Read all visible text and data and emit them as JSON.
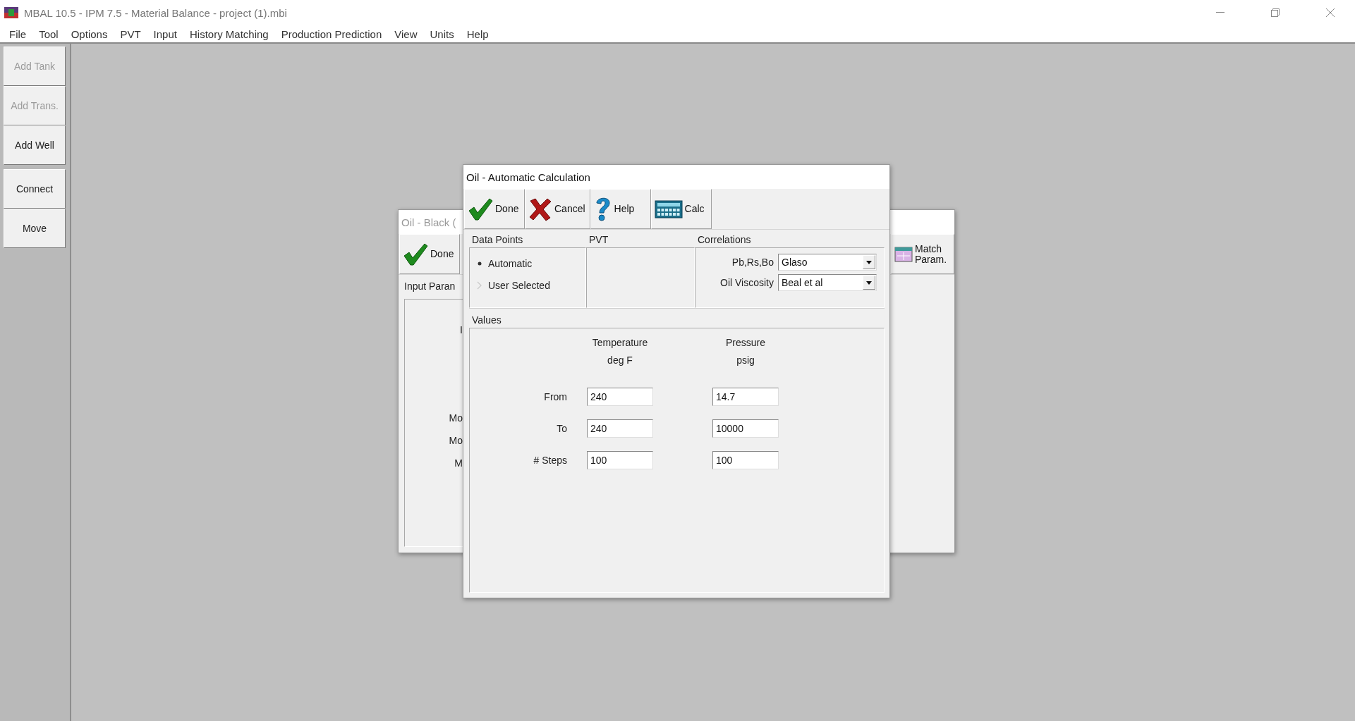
{
  "window": {
    "title": "MBAL 10.5 - IPM 7.5 - Material Balance - project (1).mbi"
  },
  "menu": [
    "File",
    "Tool",
    "Options",
    "PVT",
    "Input",
    "History Matching",
    "Production Prediction",
    "View",
    "Units",
    "Help"
  ],
  "side_toolbar": [
    [
      {
        "label": "Add Tank",
        "disabled": true
      },
      {
        "label": "Add Trans.",
        "disabled": true
      },
      {
        "label": "Add Well",
        "disabled": false
      }
    ],
    [
      {
        "label": "Connect",
        "disabled": false
      },
      {
        "label": "Move",
        "disabled": false
      }
    ]
  ],
  "background_window": {
    "title": "Oil - Black (",
    "toolbar": [
      {
        "label": "Done",
        "kind": "done"
      },
      {
        "label": "Match Param.",
        "kind": "match"
      }
    ],
    "group_title": "Input Paran",
    "labels": [
      "I",
      "Mo",
      "Mo",
      "M"
    ]
  },
  "dialog": {
    "title": "Oil - Automatic Calculation",
    "toolbar": [
      {
        "label": "Done",
        "kind": "done"
      },
      {
        "label": "Cancel",
        "kind": "cancel"
      },
      {
        "label": "Help",
        "kind": "help"
      },
      {
        "label": "Calc",
        "kind": "calc"
      }
    ],
    "data_points": {
      "title": "Data Points",
      "options": [
        {
          "label": "Automatic",
          "selected": true
        },
        {
          "label": "User Selected",
          "selected": false
        }
      ]
    },
    "pvt": {
      "title": "PVT"
    },
    "correlations": {
      "title": "Correlations",
      "fields": [
        {
          "label": "Pb,Rs,Bo",
          "value": "Glaso"
        },
        {
          "label": "Oil Viscosity",
          "value": "Beal et al"
        }
      ]
    },
    "values": {
      "title": "Values",
      "columns": [
        {
          "name": "Temperature",
          "unit": "deg F"
        },
        {
          "name": "Pressure",
          "unit": "psig"
        }
      ],
      "rows": [
        {
          "label": "From",
          "values": [
            "240",
            "14.7"
          ]
        },
        {
          "label": "To",
          "values": [
            "240",
            "10000"
          ]
        },
        {
          "label": "# Steps",
          "values": [
            "100",
            "100"
          ]
        }
      ]
    }
  }
}
